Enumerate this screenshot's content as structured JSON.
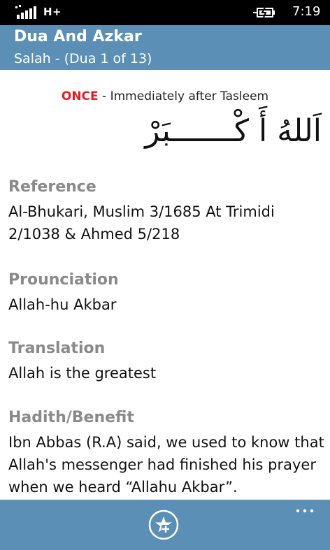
{
  "status_bar": {
    "network_type": "H+",
    "time": "7:19"
  },
  "header": {
    "title": "Dua And Azkar",
    "subtitle": "Salah - (Dua 1 of 13)"
  },
  "dua": {
    "frequency": "ONCE",
    "separator": " - ",
    "occasion": "Immediately after Tasleem",
    "arabic": "اَللهُ أَ كْـــــــبَرْ"
  },
  "sections": {
    "reference": {
      "heading": "Reference",
      "body": "Al-Bhukari, Muslim 3/1685 At Trimidi 2/1038 & Ahmed 5/218"
    },
    "pronunciation": {
      "heading": "Prounciation",
      "body": "Allah-hu Akbar"
    },
    "translation": {
      "heading": "Translation",
      "body": "Allah is the greatest"
    },
    "hadith": {
      "heading": "Hadith/Benefit",
      "body": "Ibn Abbas (R.A) said, we used to know that Allah's messenger had finished his prayer when we heard “Allahu Akbar”."
    }
  },
  "app_bar": {
    "favorite_icon": "add-favorite-star-icon",
    "more_icon": "more-dots-icon"
  },
  "colors": {
    "accent": "#5b8fb6",
    "frequency": "#e02020",
    "heading": "#8a8a8a"
  }
}
